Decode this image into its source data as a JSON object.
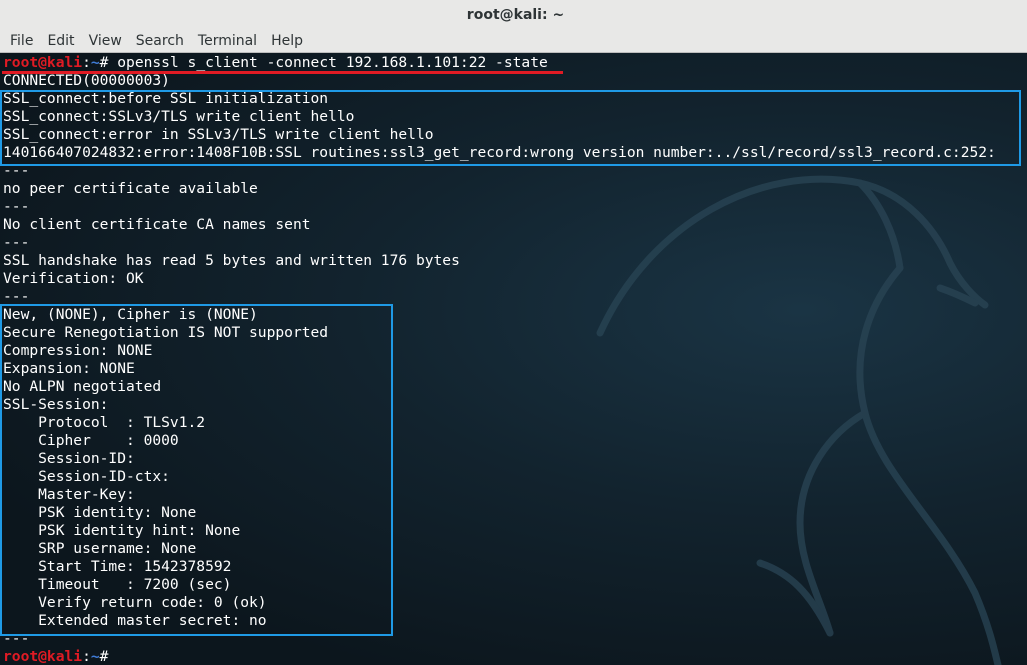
{
  "window": {
    "title": "root@kali: ~"
  },
  "menu": [
    "File",
    "Edit",
    "View",
    "Search",
    "Terminal",
    "Help"
  ],
  "prompt": {
    "user": "root@kali",
    "sep": ":",
    "path": "~",
    "symbol": "# "
  },
  "command": "openssl s_client -connect 192.168.1.101:22 -state",
  "output": [
    "CONNECTED(00000003)",
    "SSL_connect:before SSL initialization",
    "SSL_connect:SSLv3/TLS write client hello",
    "SSL_connect:error in SSLv3/TLS write client hello",
    "140166407024832:error:1408F10B:SSL routines:ssl3_get_record:wrong version number:../ssl/record/ssl3_record.c:252:",
    "---",
    "no peer certificate available",
    "---",
    "No client certificate CA names sent",
    "---",
    "SSL handshake has read 5 bytes and written 176 bytes",
    "Verification: OK",
    "---",
    "New, (NONE), Cipher is (NONE)",
    "Secure Renegotiation IS NOT supported",
    "Compression: NONE",
    "Expansion: NONE",
    "No ALPN negotiated",
    "SSL-Session:",
    "    Protocol  : TLSv1.2",
    "    Cipher    : 0000",
    "    Session-ID:",
    "    Session-ID-ctx:",
    "    Master-Key:",
    "    PSK identity: None",
    "    PSK identity hint: None",
    "    SRP username: None",
    "    Start Time: 1542378592",
    "    Timeout   : 7200 (sec)",
    "    Verify return code: 0 (ok)",
    "    Extended master secret: no",
    "---"
  ],
  "colors": {
    "highlight_box": "#1f9ae6",
    "underline": "#e01b24",
    "prompt_user": "#e01b24",
    "prompt_path": "#3f7bd6"
  }
}
